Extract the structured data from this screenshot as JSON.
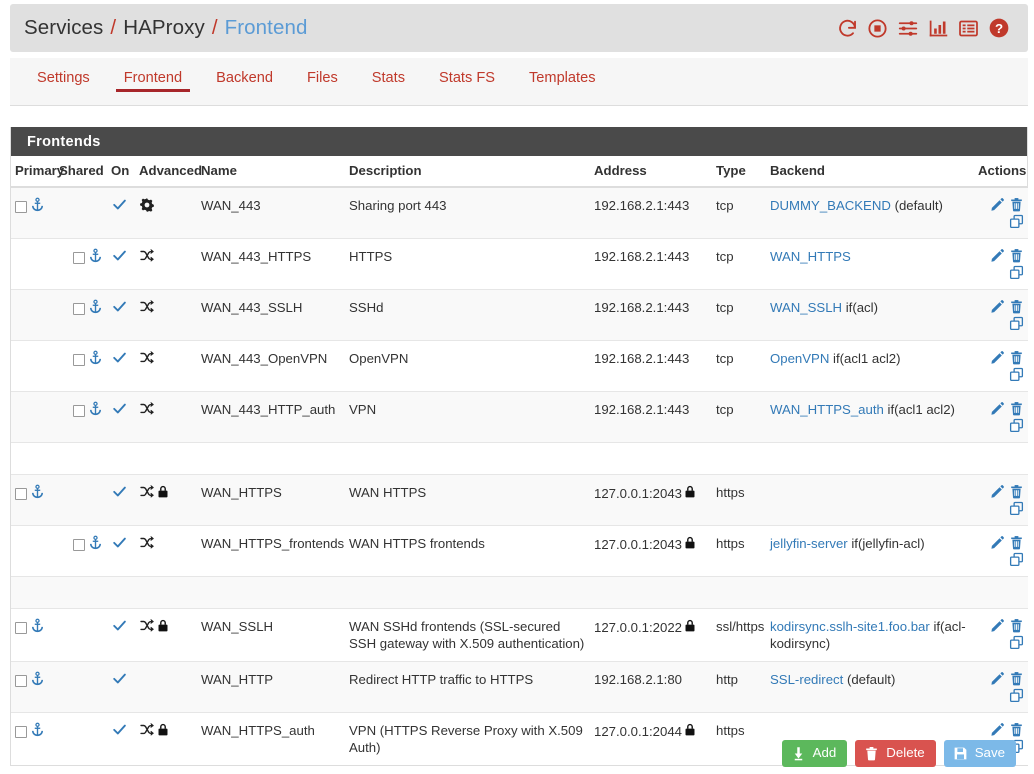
{
  "breadcrumb": {
    "root": "Services",
    "sep": "/",
    "section": "HAProxy",
    "current": "Frontend",
    "icons": [
      {
        "name": "restart-icon",
        "title": "Restart"
      },
      {
        "name": "stop-icon",
        "title": "Stop"
      },
      {
        "name": "sliders-icon",
        "title": "Settings"
      },
      {
        "name": "chart-bar-icon",
        "title": "Stats"
      },
      {
        "name": "table-list-icon",
        "title": "Table"
      },
      {
        "name": "help-icon",
        "title": "Help"
      }
    ],
    "accent_red": "#c0392b",
    "accent_blue": "#5b9bd5"
  },
  "tabs": [
    {
      "label": "Settings",
      "active": false
    },
    {
      "label": "Frontend",
      "active": true
    },
    {
      "label": "Backend",
      "active": false
    },
    {
      "label": "Files",
      "active": false
    },
    {
      "label": "Stats",
      "active": false
    },
    {
      "label": "Stats FS",
      "active": false
    },
    {
      "label": "Templates",
      "active": false
    }
  ],
  "panel": {
    "title": "Frontends",
    "header_bg": "#4a4a4a"
  },
  "table": {
    "columns": [
      "Primary",
      "Shared",
      "On",
      "Advanced",
      "Name",
      "Description",
      "Address",
      "Type",
      "Backend",
      "Actions"
    ],
    "rows": [
      {
        "kind": "row",
        "stripe": "striped",
        "primary_checkbox": true,
        "primary_anchor": true,
        "shared_checkbox": false,
        "shared_anchor": false,
        "on": true,
        "advanced": "gear",
        "lock": false,
        "name": "WAN_443",
        "description": "Sharing port 443",
        "address": "192.168.2.1:443",
        "address_lock": false,
        "type": "tcp",
        "backend_link": "DUMMY_BACKEND",
        "backend_suffix": " (default)"
      },
      {
        "kind": "row",
        "stripe": "plain",
        "primary_checkbox": false,
        "primary_anchor": false,
        "shared_checkbox": true,
        "shared_anchor": true,
        "on": true,
        "advanced": "shuffle",
        "lock": false,
        "name": "WAN_443_HTTPS",
        "description": "HTTPS",
        "address": "192.168.2.1:443",
        "address_lock": false,
        "type": "tcp",
        "backend_link": "WAN_HTTPS",
        "backend_suffix": ""
      },
      {
        "kind": "row",
        "stripe": "striped",
        "primary_checkbox": false,
        "primary_anchor": false,
        "shared_checkbox": true,
        "shared_anchor": true,
        "on": true,
        "advanced": "shuffle",
        "lock": false,
        "name": "WAN_443_SSLH",
        "description": "SSHd",
        "address": "192.168.2.1:443",
        "address_lock": false,
        "type": "tcp",
        "backend_link": "WAN_SSLH",
        "backend_suffix": " if(acl)"
      },
      {
        "kind": "row",
        "stripe": "plain",
        "primary_checkbox": false,
        "primary_anchor": false,
        "shared_checkbox": true,
        "shared_anchor": true,
        "on": true,
        "advanced": "shuffle",
        "lock": false,
        "name": "WAN_443_OpenVPN",
        "description": "OpenVPN",
        "address": "192.168.2.1:443",
        "address_lock": false,
        "type": "tcp",
        "backend_link": "OpenVPN",
        "backend_suffix": " if(acl1 acl2)"
      },
      {
        "kind": "row",
        "stripe": "striped",
        "primary_checkbox": false,
        "primary_anchor": false,
        "shared_checkbox": true,
        "shared_anchor": true,
        "on": true,
        "advanced": "shuffle",
        "lock": false,
        "name": "WAN_443_HTTP_auth",
        "description": "VPN",
        "address": "192.168.2.1:443",
        "address_lock": false,
        "type": "tcp",
        "backend_link": "WAN_HTTPS_auth",
        "backend_suffix": " if(acl1 acl2)"
      },
      {
        "kind": "spacer",
        "stripe": "plain"
      },
      {
        "kind": "row",
        "stripe": "striped",
        "primary_checkbox": true,
        "primary_anchor": true,
        "shared_checkbox": false,
        "shared_anchor": false,
        "on": true,
        "advanced": "shuffle",
        "lock": true,
        "name": "WAN_HTTPS",
        "description": "WAN HTTPS",
        "address": "127.0.0.1:2043",
        "address_lock": true,
        "type": "https",
        "backend_link": "",
        "backend_suffix": ""
      },
      {
        "kind": "row",
        "stripe": "plain",
        "primary_checkbox": false,
        "primary_anchor": false,
        "shared_checkbox": true,
        "shared_anchor": true,
        "on": true,
        "advanced": "shuffle",
        "lock": false,
        "name": "WAN_HTTPS_frontends",
        "description": "WAN HTTPS frontends",
        "address": "127.0.0.1:2043",
        "address_lock": true,
        "type": "https",
        "backend_link": "jellyfin-server",
        "backend_suffix": " if(jellyfin-acl)"
      },
      {
        "kind": "spacer",
        "stripe": "striped"
      },
      {
        "kind": "row",
        "stripe": "plain",
        "primary_checkbox": true,
        "primary_anchor": true,
        "shared_checkbox": false,
        "shared_anchor": false,
        "on": true,
        "advanced": "shuffle",
        "lock": true,
        "name": "WAN_SSLH",
        "description": "WAN SSHd frontends (SSL-secured SSH gateway with X.509 authentication)",
        "address": "127.0.0.1:2022",
        "address_lock": true,
        "type": "ssl/https",
        "backend_link": "kodirsync.sslh-site1.foo.bar",
        "backend_suffix": " if(acl-kodirsync)"
      },
      {
        "kind": "row",
        "stripe": "striped",
        "primary_checkbox": true,
        "primary_anchor": true,
        "shared_checkbox": false,
        "shared_anchor": false,
        "on": true,
        "advanced": "none",
        "lock": false,
        "name": "WAN_HTTP",
        "description": "Redirect HTTP traffic to HTTPS",
        "address": "192.168.2.1:80",
        "address_lock": false,
        "type": "http",
        "backend_link": "SSL-redirect",
        "backend_suffix": " (default)"
      },
      {
        "kind": "row",
        "stripe": "plain",
        "primary_checkbox": true,
        "primary_anchor": true,
        "shared_checkbox": false,
        "shared_anchor": false,
        "on": true,
        "advanced": "shuffle",
        "lock": true,
        "name": "WAN_HTTPS_auth",
        "description": "VPN (HTTPS Reverse Proxy with X.509 Auth)",
        "address": "127.0.0.1:2044",
        "address_lock": true,
        "type": "https",
        "backend_link": "",
        "backend_suffix": ""
      }
    ],
    "row_actions": [
      {
        "name": "edit-icon",
        "title": "Edit"
      },
      {
        "name": "delete-icon",
        "title": "Delete"
      },
      {
        "name": "copy-icon",
        "title": "Duplicate"
      }
    ]
  },
  "footer": {
    "buttons": [
      {
        "label": "Add",
        "icon": "add-icon",
        "color": "#5cb85c"
      },
      {
        "label": "Delete",
        "icon": "trash-icon",
        "color": "#d9534f"
      },
      {
        "label": "Save",
        "icon": "save-icon",
        "color": "#7cb9e8"
      }
    ]
  }
}
